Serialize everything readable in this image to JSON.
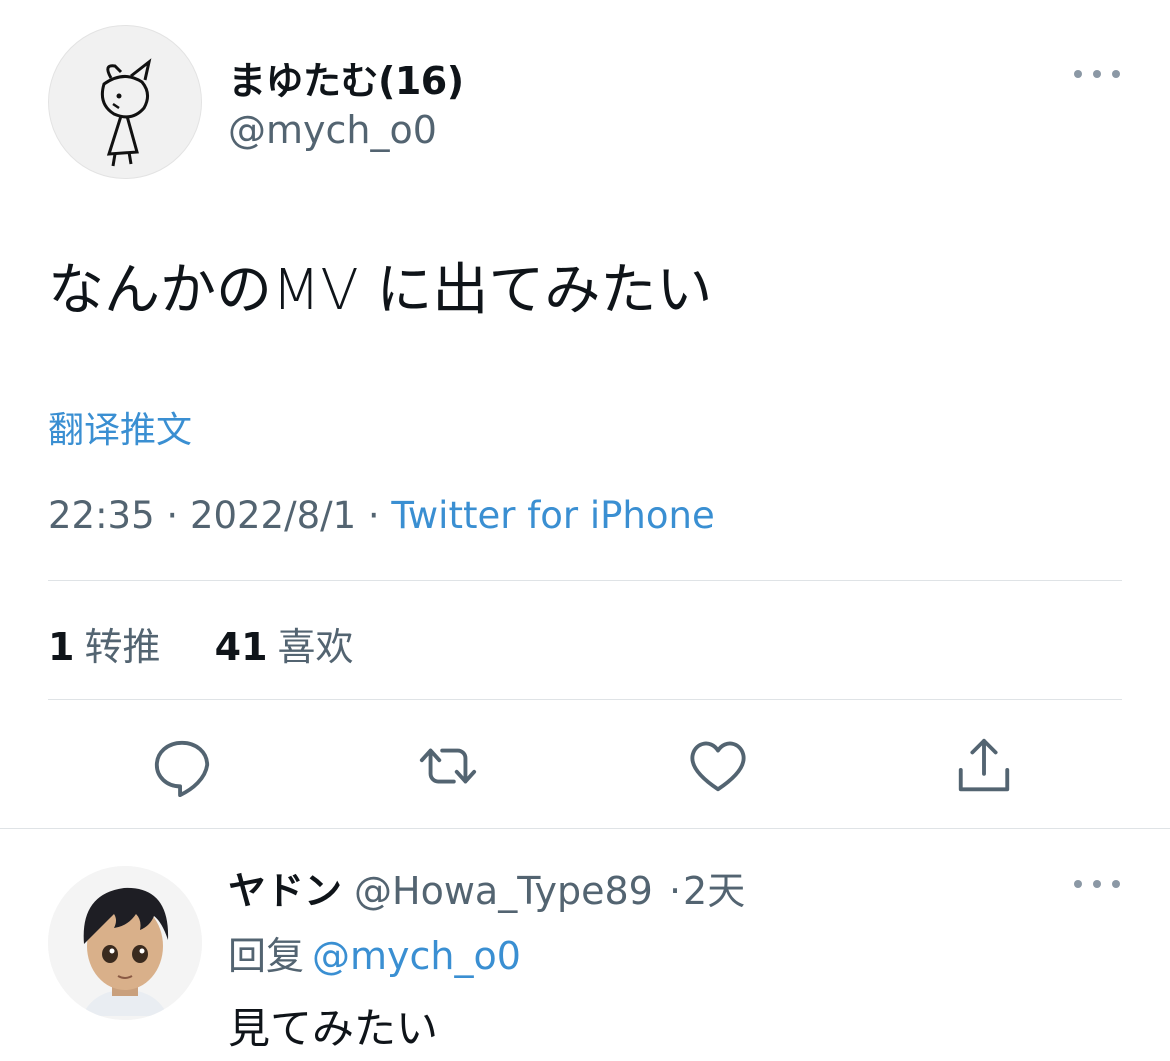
{
  "tweet": {
    "author": {
      "display_name": "まゆたむ(16)",
      "handle": "@mych_o0"
    },
    "text": "なんかのMV に出てみたい",
    "translate_label": "翻译推文",
    "time": "22:35",
    "separator": "·",
    "date": "2022/8/1",
    "source": "Twitter for iPhone",
    "stats": {
      "retweet_count": "1",
      "retweet_label": "转推",
      "like_count": "41",
      "like_label": "喜欢"
    },
    "actions": [
      "reply-icon",
      "retweet-icon",
      "like-icon",
      "share-icon"
    ],
    "more_icon": "more-icon"
  },
  "reply": {
    "display_name": "ヤドン",
    "handle": "@Howa_Type89",
    "separator": "·",
    "time_ago": "2天",
    "reply_to_label": "回复",
    "reply_to_handle": "@mych_o0",
    "text": "見てみたい"
  },
  "colors": {
    "link": "#3a8fd2",
    "secondary_text": "#536471",
    "divider": "#dfe3e6"
  }
}
